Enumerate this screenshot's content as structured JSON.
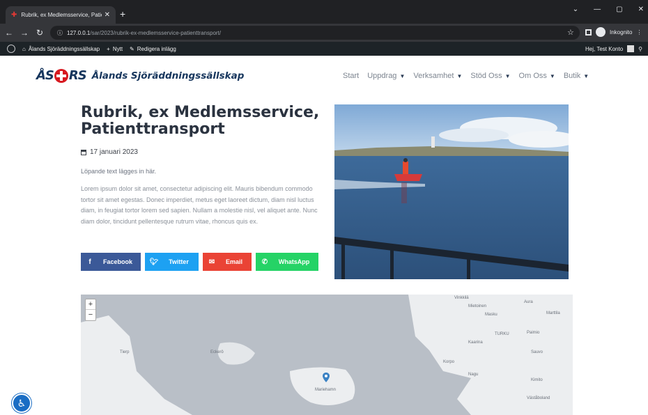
{
  "browser": {
    "tab_title": "Rubrik, ex Medlemsservice, Patie",
    "url_host": "127.0.0.1",
    "url_path": "/sar/2023/rubrik-ex-medlemsservice-patienttransport/",
    "profile_label": "Inkognito"
  },
  "wpbar": {
    "site_name": "Ålands Sjöräddningssällskap",
    "new_label": "Nytt",
    "edit_label": "Redigera inlägg",
    "greeting": "Hej, Test Konto"
  },
  "site": {
    "logo_left": "ÅS",
    "logo_right": "RS",
    "name": "Ålands Sjöräddningssällskap",
    "nav": [
      "Start",
      "Uppdrag",
      "Verksamhet",
      "Stöd Oss",
      "Om Oss",
      "Butik"
    ]
  },
  "post": {
    "title": "Rubrik, ex Medlemsservice, Patienttransport",
    "date": "17 januari 2023",
    "lead": "Löpande text lägges in här.",
    "body": "Lorem ipsum dolor sit amet, consectetur adipiscing elit. Mauris bibendum commodo tortor sit amet egestas. Donec imperdiet, metus eget laoreet dictum, diam nisl luctus diam, in feugiat tortor lorem sed sapien. Nullam a molestie nisl, vel aliquet ante. Nunc diam dolor, tincidunt pellentesque rutrum vitae, rhoncus quis ex."
  },
  "share": {
    "facebook": "Facebook",
    "twitter": "Twitter",
    "email": "Email",
    "whatsapp": "WhatsApp"
  },
  "map": {
    "zoom_in": "+",
    "zoom_out": "−",
    "labels": [
      "Vinkkilä",
      "Mietoinen",
      "Aura",
      "Masku",
      "Marttila",
      "TURKU",
      "Paimio",
      "Kaarina",
      "Sauvo",
      "Tierp",
      "Eckerö",
      "Mariehamn",
      "Korpo",
      "Nagu",
      "Kimito",
      "Väståboland"
    ]
  },
  "colors": {
    "facebook": "#3b5998",
    "twitter": "#1da1f2",
    "email": "#ea4335",
    "whatsapp": "#25d366",
    "brand_blue": "#17365d",
    "brand_red": "#d71920"
  }
}
